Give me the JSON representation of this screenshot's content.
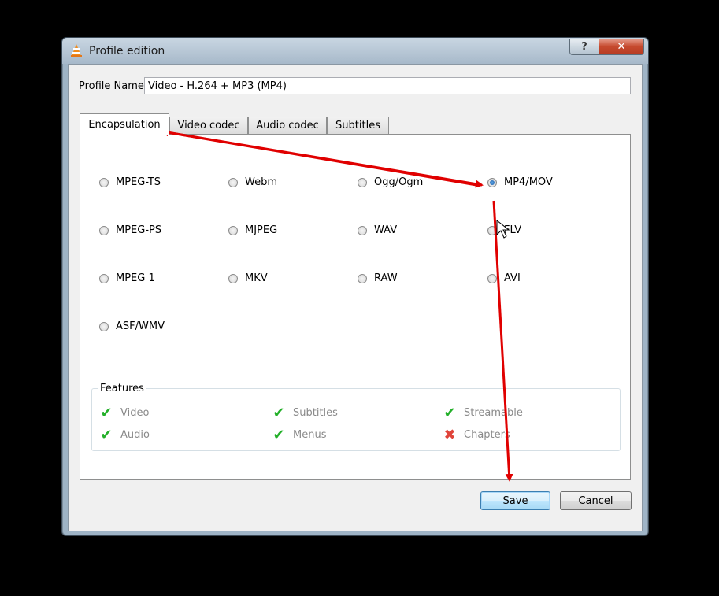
{
  "window": {
    "title": "Profile edition",
    "help_label": "?",
    "close_label": "✕"
  },
  "profile": {
    "name_label": "Profile Name",
    "name_value": "Video - H.264 + MP3 (MP4)"
  },
  "tabs": [
    {
      "label": "Encapsulation",
      "active": true
    },
    {
      "label": "Video codec",
      "active": false
    },
    {
      "label": "Audio codec",
      "active": false
    },
    {
      "label": "Subtitles",
      "active": false
    }
  ],
  "encapsulation": {
    "options": [
      {
        "label": "MPEG-TS",
        "selected": false
      },
      {
        "label": "Webm",
        "selected": false
      },
      {
        "label": "Ogg/Ogm",
        "selected": false
      },
      {
        "label": "MP4/MOV",
        "selected": true
      },
      {
        "label": "MPEG-PS",
        "selected": false
      },
      {
        "label": "MJPEG",
        "selected": false
      },
      {
        "label": "WAV",
        "selected": false
      },
      {
        "label": "FLV",
        "selected": false
      },
      {
        "label": "MPEG 1",
        "selected": false
      },
      {
        "label": "MKV",
        "selected": false
      },
      {
        "label": "RAW",
        "selected": false
      },
      {
        "label": "AVI",
        "selected": false
      },
      {
        "label": "ASF/WMV",
        "selected": false
      }
    ]
  },
  "features": {
    "label": "Features",
    "items": [
      {
        "label": "Video",
        "supported": true,
        "icon": "check-icon"
      },
      {
        "label": "Subtitles",
        "supported": true,
        "icon": "check-icon"
      },
      {
        "label": "Streamable",
        "supported": true,
        "icon": "check-icon"
      },
      {
        "label": "Audio",
        "supported": true,
        "icon": "check-icon"
      },
      {
        "label": "Menus",
        "supported": true,
        "icon": "check-icon"
      },
      {
        "label": "Chapters",
        "supported": false,
        "icon": "cross-icon"
      }
    ]
  },
  "buttons": {
    "save": "Save",
    "cancel": "Cancel"
  },
  "colors": {
    "annotation_arrow": "#e00000",
    "check": "#24b02a",
    "cross": "#e0443a"
  }
}
